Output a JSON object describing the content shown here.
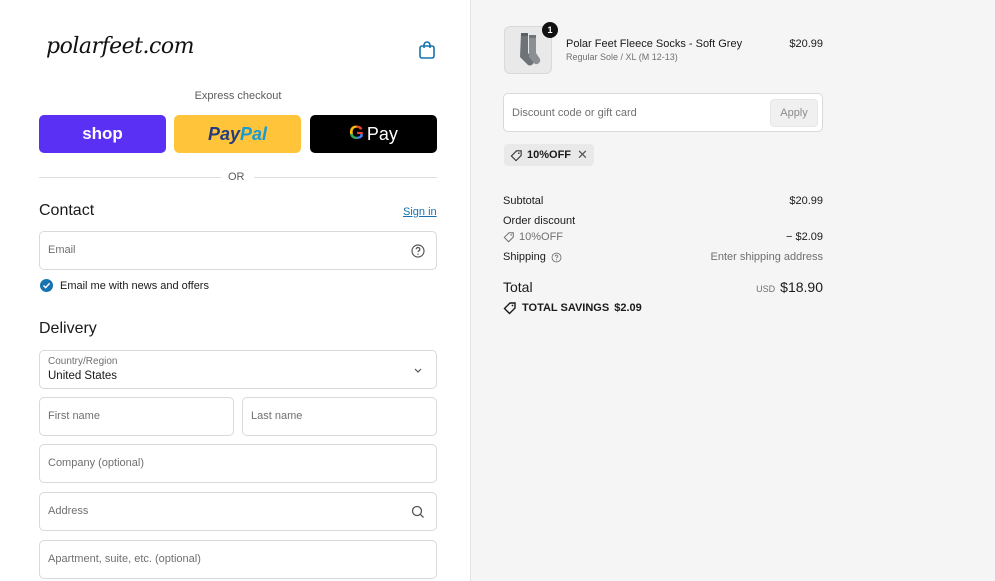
{
  "header": {
    "logo_text": "polarfeet.com",
    "cart_icon": "shopping-bag-icon"
  },
  "express": {
    "title": "Express checkout",
    "shop_label": "shop",
    "paypal_label_1": "Pay",
    "paypal_label_2": "Pal",
    "gpay_g": "G",
    "gpay_label": "Pay",
    "or_label": "OR"
  },
  "contact": {
    "title": "Contact",
    "sign_in": "Sign in",
    "email_placeholder": "Email",
    "newsletter_label": "Email me with news and offers",
    "newsletter_checked": true
  },
  "delivery": {
    "title": "Delivery",
    "country_label": "Country/Region",
    "country_value": "United States",
    "first_name_placeholder": "First name",
    "last_name_placeholder": "Last name",
    "company_placeholder": "Company (optional)",
    "address_placeholder": "Address",
    "apartment_placeholder": "Apartment, suite, etc. (optional)"
  },
  "summary": {
    "product": {
      "quantity": "1",
      "name": "Polar Feet Fleece Socks - Soft Grey",
      "variant": "Regular Sole / XL (M 12-13)",
      "price": "$20.99"
    },
    "discount_placeholder": "Discount code or gift card",
    "apply_label": "Apply",
    "applied_code": "10%OFF",
    "subtotal_label": "Subtotal",
    "subtotal_value": "$20.99",
    "order_discount_label": "Order discount",
    "order_discount_code": "10%OFF",
    "order_discount_value": "− $2.09",
    "shipping_label": "Shipping",
    "shipping_value": "Enter shipping address",
    "total_label": "Total",
    "total_currency": "USD",
    "total_value": "$18.90",
    "savings_label": "TOTAL SAVINGS",
    "savings_value": "$2.09"
  },
  "colors": {
    "accent": "#1773b0",
    "shop_purple": "#5a31f4",
    "paypal_yellow": "#ffc439",
    "gpay_black": "#000000"
  }
}
